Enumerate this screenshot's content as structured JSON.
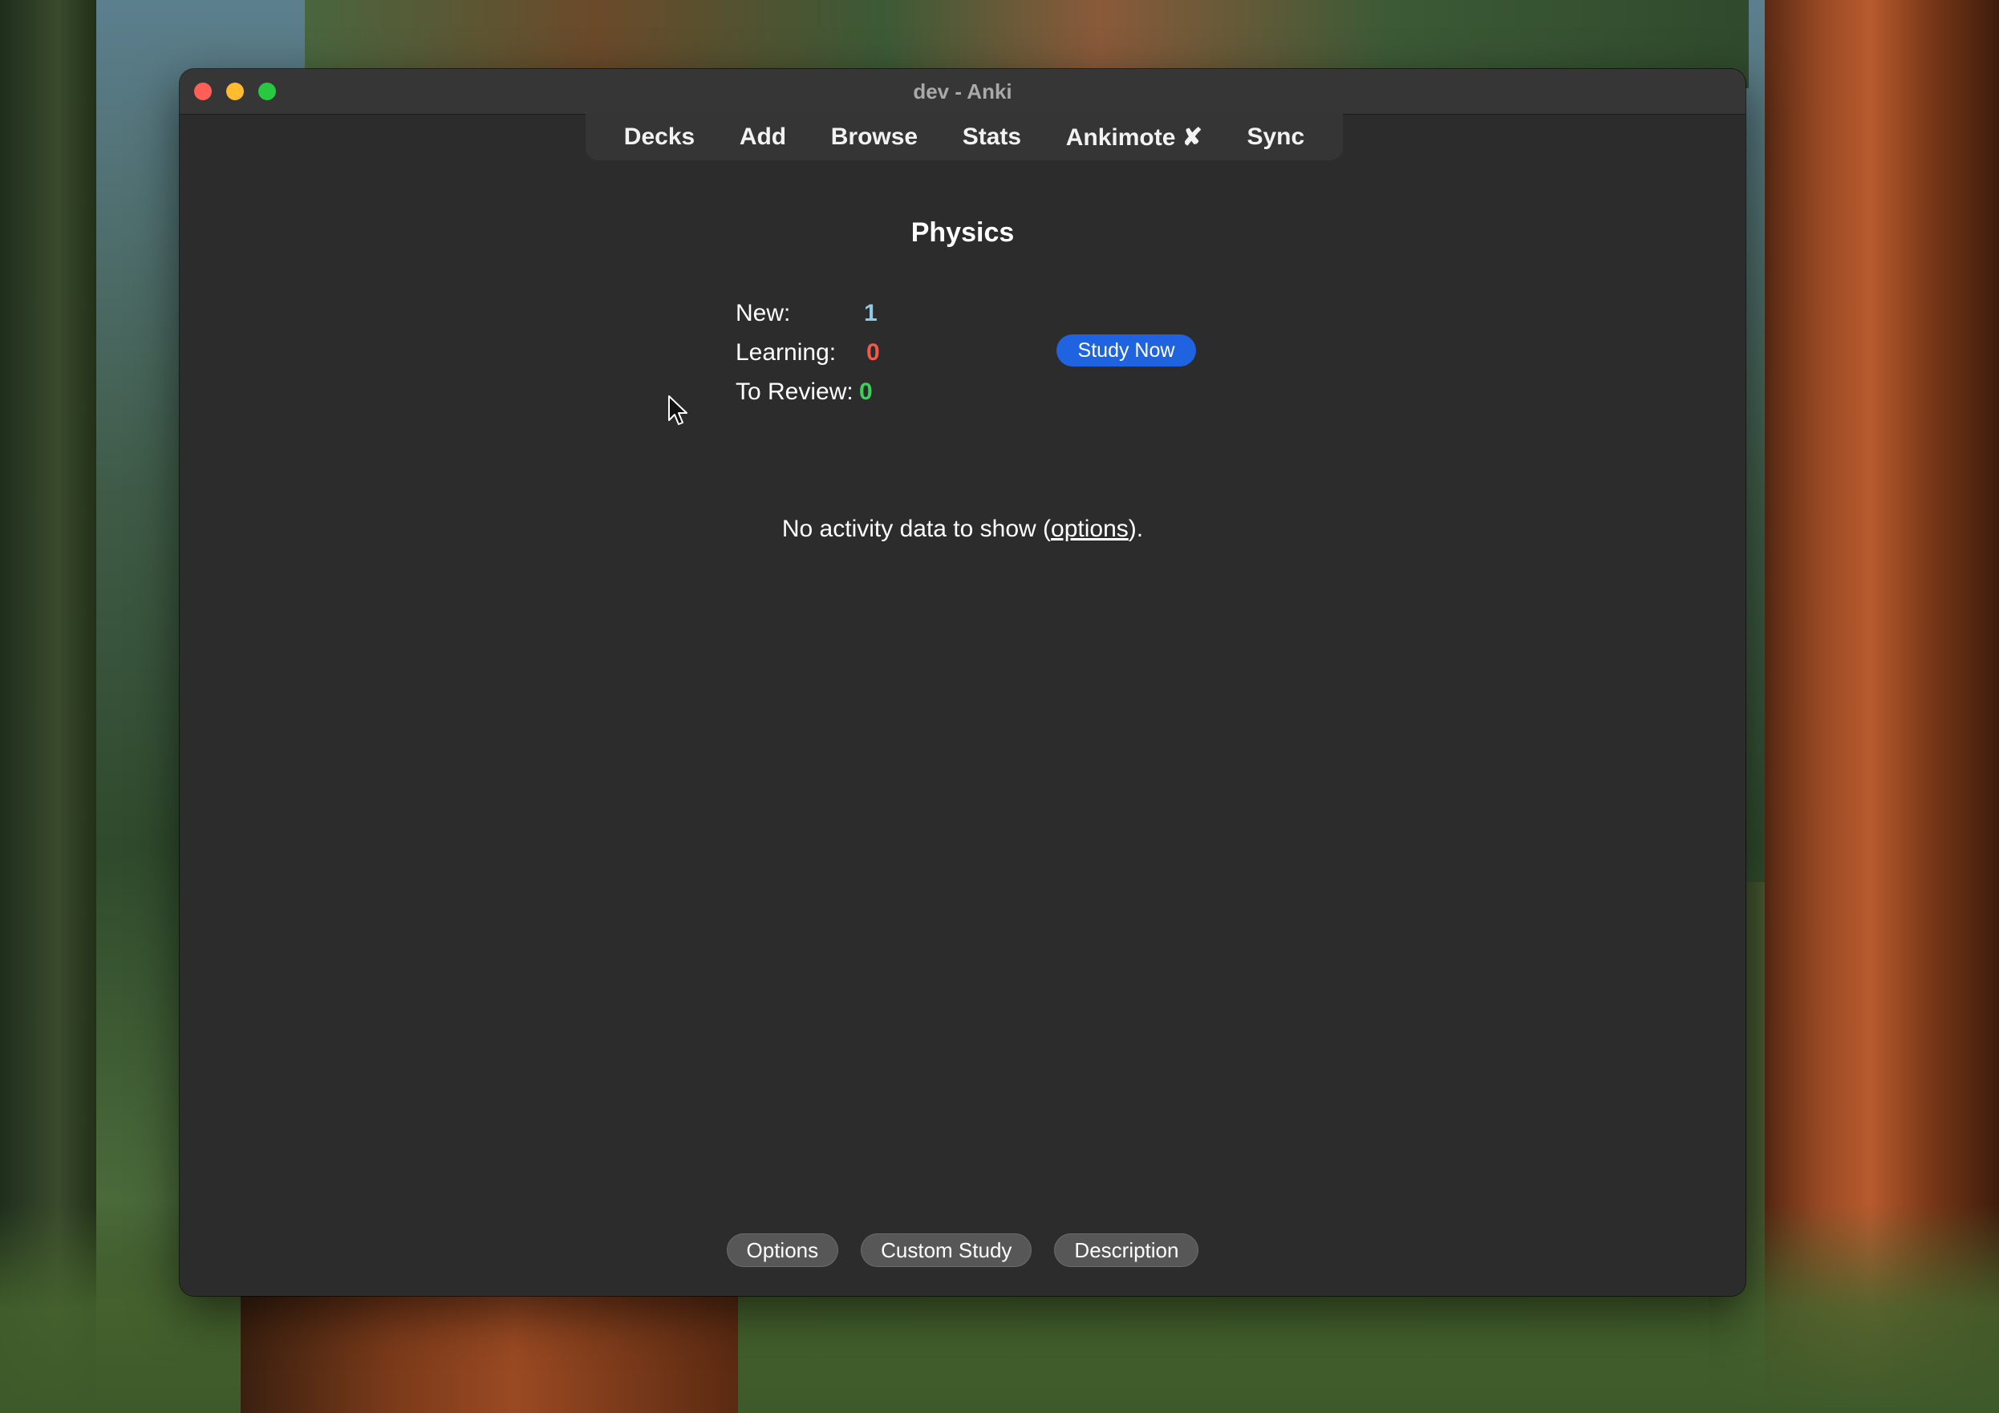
{
  "window": {
    "title": "dev - Anki"
  },
  "toolbar": {
    "items": [
      "Decks",
      "Add",
      "Browse",
      "Stats",
      "Ankimote ✘",
      "Sync"
    ]
  },
  "deck": {
    "title": "Physics",
    "counts": [
      {
        "label": "New:",
        "value": "1"
      },
      {
        "label": "Learning:",
        "value": "0"
      },
      {
        "label": "To Review:",
        "value": "0"
      }
    ],
    "study_now_label": "Study Now"
  },
  "activity": {
    "text_before": "No activity data to show (",
    "link": "options",
    "text_after": ")."
  },
  "bottom_buttons": {
    "options": "Options",
    "custom_study": "Custom Study",
    "description": "Description"
  },
  "colors": {
    "new": "#8ecae6",
    "learning": "#f05a4a",
    "review": "#3ccf5a",
    "accent": "#1f63e0"
  }
}
